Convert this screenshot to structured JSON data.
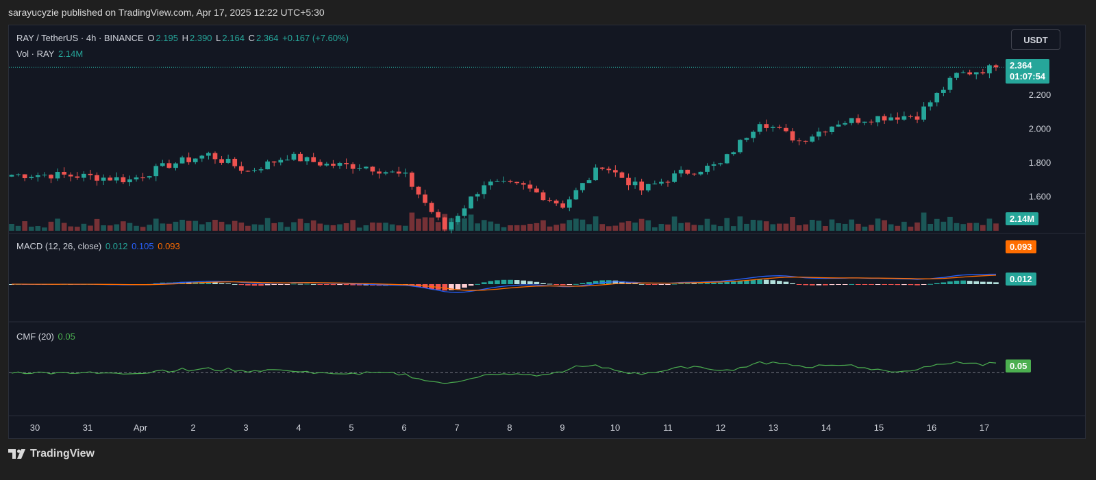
{
  "header": {
    "publisher_line": "sarayucyzie published on TradingView.com, Apr 17, 2025 12:22 UTC+5:30"
  },
  "footer": {
    "brand": "TradingView"
  },
  "legend": {
    "symbol": "RAY / TetherUS · 4h · BINANCE",
    "o_label": "O",
    "o_value": "2.195",
    "h_label": "H",
    "h_value": "2.390",
    "l_label": "L",
    "l_value": "2.164",
    "c_label": "C",
    "c_value": "2.364",
    "change": "+0.167 (+7.60%)",
    "vol_label": "Vol · RAY",
    "vol_value": "2.14M",
    "macd_label": "MACD (12, 26, close)",
    "macd_hist": "0.012",
    "macd_line": "0.105",
    "macd_signal": "0.093",
    "cmf_label": "CMF (20)",
    "cmf_value": "0.05"
  },
  "currency_button": "USDT",
  "price_tag": {
    "price": "2.364",
    "countdown": "01:07:54"
  },
  "vol_tag": "2.14M",
  "macd_signal_tag": "0.093",
  "macd_hist_tag": "0.012",
  "cmf_tag": "0.05",
  "x_axis_labels": [
    "30",
    "31",
    "Apr",
    "2",
    "3",
    "4",
    "5",
    "6",
    "7",
    "8",
    "9",
    "10",
    "11",
    "12",
    "13",
    "14",
    "15",
    "16",
    "17"
  ],
  "colors": {
    "up": "#26a69a",
    "down": "#ef5350",
    "macd": "#2962ff",
    "signal": "#ff6d00",
    "cmf": "#4caf50",
    "background": "#131722"
  },
  "chart_data": {
    "type": "candlestick",
    "title": "RAY / TetherUS · 4h · BINANCE",
    "price_axis": {
      "ticks": [
        1.6,
        1.8,
        2.0,
        2.2
      ],
      "ylim": [
        1.4,
        2.45
      ],
      "last_price": 2.364
    },
    "x_labels": [
      "30",
      "31",
      "Apr",
      "2",
      "3",
      "4",
      "5",
      "6",
      "7",
      "8",
      "9",
      "10",
      "11",
      "12",
      "13",
      "14",
      "15",
      "16",
      "17"
    ],
    "days_close": [
      1.73,
      1.73,
      1.72,
      1.7,
      1.79,
      1.85,
      1.75,
      1.84,
      1.79,
      1.78,
      1.72,
      1.41,
      1.68,
      1.66,
      1.55,
      1.79,
      1.64,
      1.74,
      1.79,
      2.05,
      1.93,
      2.04,
      2.07,
      2.08,
      2.32,
      2.364
    ],
    "candles_per_day": 6,
    "macd": {
      "hist": 0.012,
      "line": 0.105,
      "signal": 0.093
    },
    "cmf": {
      "value": 0.05
    },
    "volume_last": "2.14M"
  }
}
